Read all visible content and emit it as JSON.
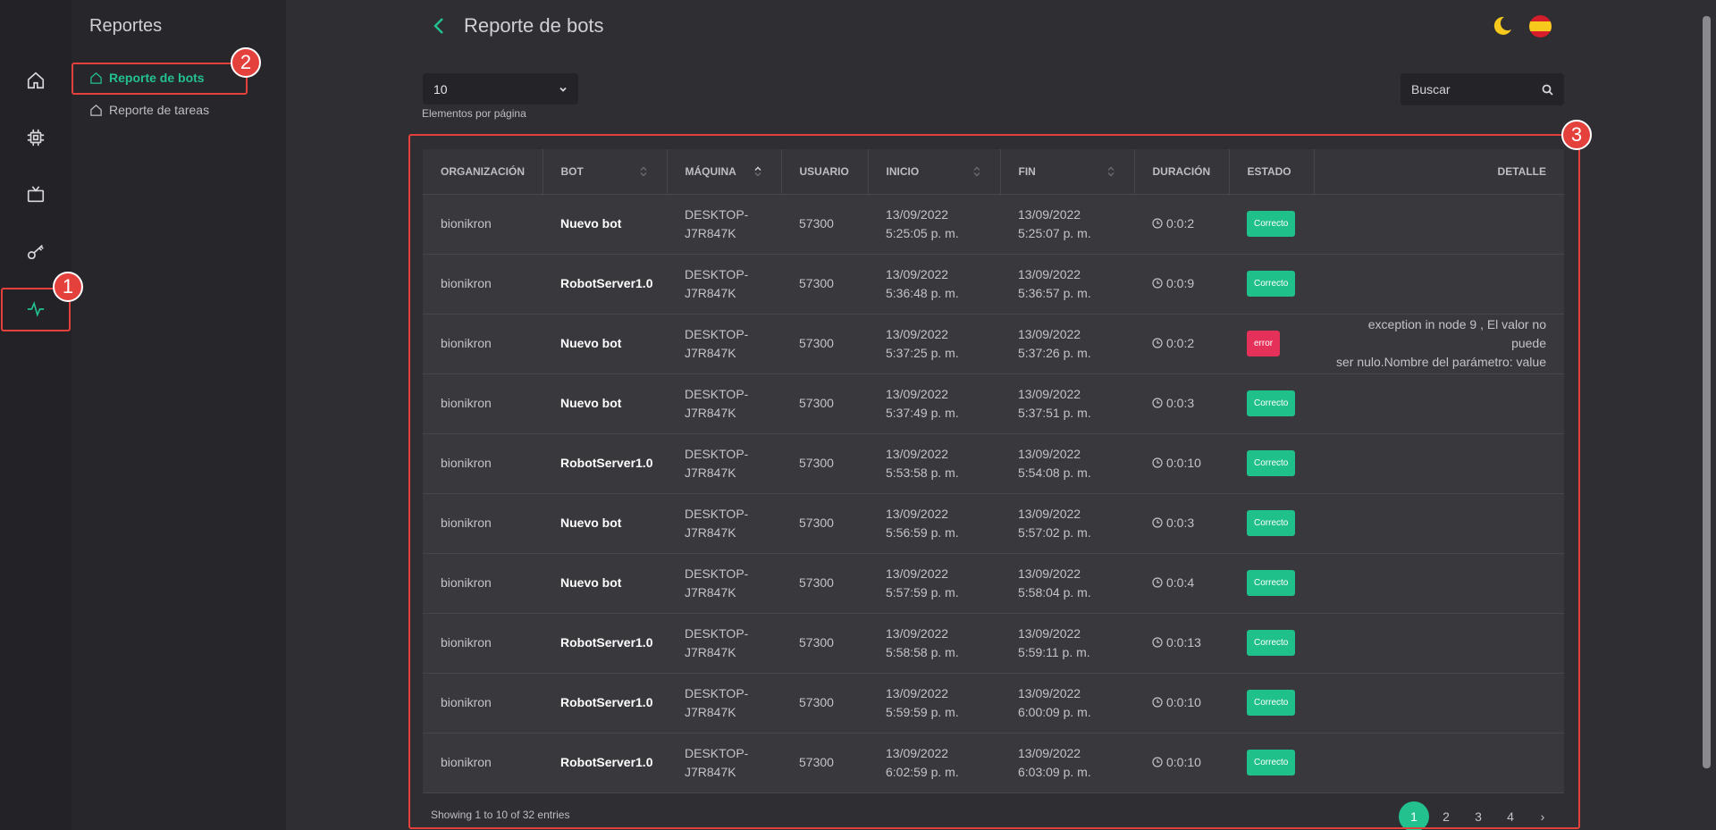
{
  "sidebar": {
    "title": "Reportes",
    "items": [
      {
        "label": "Reporte de bots",
        "active": true
      },
      {
        "label": "Reporte de tareas",
        "active": false
      }
    ]
  },
  "rail": {
    "icons": [
      "home-icon",
      "chip-icon",
      "tv-icon",
      "key-icon",
      "activity-icon"
    ],
    "active": "activity-icon"
  },
  "header": {
    "title": "Reporte de bots"
  },
  "controls": {
    "per_page_value": "10",
    "per_page_label": "Elementos por página",
    "search_placeholder": "Buscar"
  },
  "table": {
    "columns": [
      "ORGANIZACIÓN",
      "BOT",
      "MÁQUINA",
      "USUARIO",
      "INICIO",
      "FIN",
      "DURACIÓN",
      "ESTADO",
      "DETALLE"
    ],
    "rows": [
      {
        "org": "bionikron",
        "bot": "Nuevo bot",
        "machine_1": "DESKTOP-",
        "machine_2": "J7R847K",
        "user": "57300",
        "start_date": "13/09/2022",
        "start_time": "5:25:05 p. m.",
        "end_date": "13/09/2022",
        "end_time": "5:25:07 p. m.",
        "duration": "0:0:2",
        "status": "Correcto",
        "detail_1": "",
        "detail_2": ""
      },
      {
        "org": "bionikron",
        "bot": "RobotServer1.0",
        "machine_1": "DESKTOP-",
        "machine_2": "J7R847K",
        "user": "57300",
        "start_date": "13/09/2022",
        "start_time": "5:36:48 p. m.",
        "end_date": "13/09/2022",
        "end_time": "5:36:57 p. m.",
        "duration": "0:0:9",
        "status": "Correcto",
        "detail_1": "",
        "detail_2": ""
      },
      {
        "org": "bionikron",
        "bot": "Nuevo bot",
        "machine_1": "DESKTOP-",
        "machine_2": "J7R847K",
        "user": "57300",
        "start_date": "13/09/2022",
        "start_time": "5:37:25 p. m.",
        "end_date": "13/09/2022",
        "end_time": "5:37:26 p. m.",
        "duration": "0:0:2",
        "status": "error",
        "detail_1": "exception in node 9 , El valor no puede",
        "detail_2": "ser nulo.Nombre del parámetro: value"
      },
      {
        "org": "bionikron",
        "bot": "Nuevo bot",
        "machine_1": "DESKTOP-",
        "machine_2": "J7R847K",
        "user": "57300",
        "start_date": "13/09/2022",
        "start_time": "5:37:49 p. m.",
        "end_date": "13/09/2022",
        "end_time": "5:37:51 p. m.",
        "duration": "0:0:3",
        "status": "Correcto",
        "detail_1": "",
        "detail_2": ""
      },
      {
        "org": "bionikron",
        "bot": "RobotServer1.0",
        "machine_1": "DESKTOP-",
        "machine_2": "J7R847K",
        "user": "57300",
        "start_date": "13/09/2022",
        "start_time": "5:53:58 p. m.",
        "end_date": "13/09/2022",
        "end_time": "5:54:08 p. m.",
        "duration": "0:0:10",
        "status": "Correcto",
        "detail_1": "",
        "detail_2": ""
      },
      {
        "org": "bionikron",
        "bot": "Nuevo bot",
        "machine_1": "DESKTOP-",
        "machine_2": "J7R847K",
        "user": "57300",
        "start_date": "13/09/2022",
        "start_time": "5:56:59 p. m.",
        "end_date": "13/09/2022",
        "end_time": "5:57:02 p. m.",
        "duration": "0:0:3",
        "status": "Correcto",
        "detail_1": "",
        "detail_2": ""
      },
      {
        "org": "bionikron",
        "bot": "Nuevo bot",
        "machine_1": "DESKTOP-",
        "machine_2": "J7R847K",
        "user": "57300",
        "start_date": "13/09/2022",
        "start_time": "5:57:59 p. m.",
        "end_date": "13/09/2022",
        "end_time": "5:58:04 p. m.",
        "duration": "0:0:4",
        "status": "Correcto",
        "detail_1": "",
        "detail_2": ""
      },
      {
        "org": "bionikron",
        "bot": "RobotServer1.0",
        "machine_1": "DESKTOP-",
        "machine_2": "J7R847K",
        "user": "57300",
        "start_date": "13/09/2022",
        "start_time": "5:58:58 p. m.",
        "end_date": "13/09/2022",
        "end_time": "5:59:11 p. m.",
        "duration": "0:0:13",
        "status": "Correcto",
        "detail_1": "",
        "detail_2": ""
      },
      {
        "org": "bionikron",
        "bot": "RobotServer1.0",
        "machine_1": "DESKTOP-",
        "machine_2": "J7R847K",
        "user": "57300",
        "start_date": "13/09/2022",
        "start_time": "5:59:59 p. m.",
        "end_date": "13/09/2022",
        "end_time": "6:00:09 p. m.",
        "duration": "0:0:10",
        "status": "Correcto",
        "detail_1": "",
        "detail_2": ""
      },
      {
        "org": "bionikron",
        "bot": "RobotServer1.0",
        "machine_1": "DESKTOP-",
        "machine_2": "J7R847K",
        "user": "57300",
        "start_date": "13/09/2022",
        "start_time": "6:02:59 p. m.",
        "end_date": "13/09/2022",
        "end_time": "6:03:09 p. m.",
        "duration": "0:0:10",
        "status": "Correcto",
        "detail_1": "",
        "detail_2": ""
      }
    ]
  },
  "footer": {
    "entries_text": "Showing 1 to 10 of 32 entries",
    "pages": [
      "1",
      "2",
      "3",
      "4"
    ],
    "current_page": "1",
    "next": "›"
  },
  "callouts": [
    "1",
    "2",
    "3"
  ],
  "colors": {
    "accent": "#23c18d",
    "callout": "#e5413c",
    "error": "#e5305a"
  }
}
